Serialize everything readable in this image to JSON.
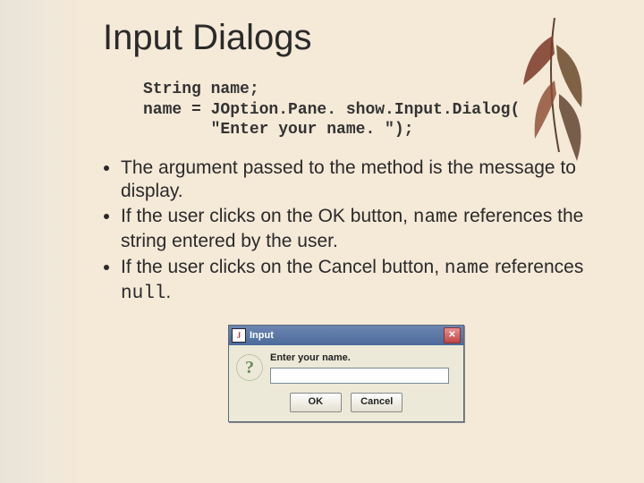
{
  "title": "Input Dialogs",
  "code": {
    "l1": "String name;",
    "l2": "name = JOption.Pane. show.Input.Dialog(",
    "l3": "       \"Enter your name. \");"
  },
  "bullets": {
    "b1a": "The argument passed to the method is the message to display.",
    "b2a": "If the user clicks on the OK button, ",
    "b2b": "name",
    "b2c": " references the string entered by the user.",
    "b3a": "If the user clicks on the Cancel button, ",
    "b3b": "name",
    "b3c": " references ",
    "b3d": "null",
    "b3e": "."
  },
  "dialog": {
    "title": "Input",
    "message": "Enter your name.",
    "ok": "OK",
    "cancel": "Cancel",
    "close_glyph": "✕",
    "java_badge": "J",
    "question_glyph": "?"
  }
}
